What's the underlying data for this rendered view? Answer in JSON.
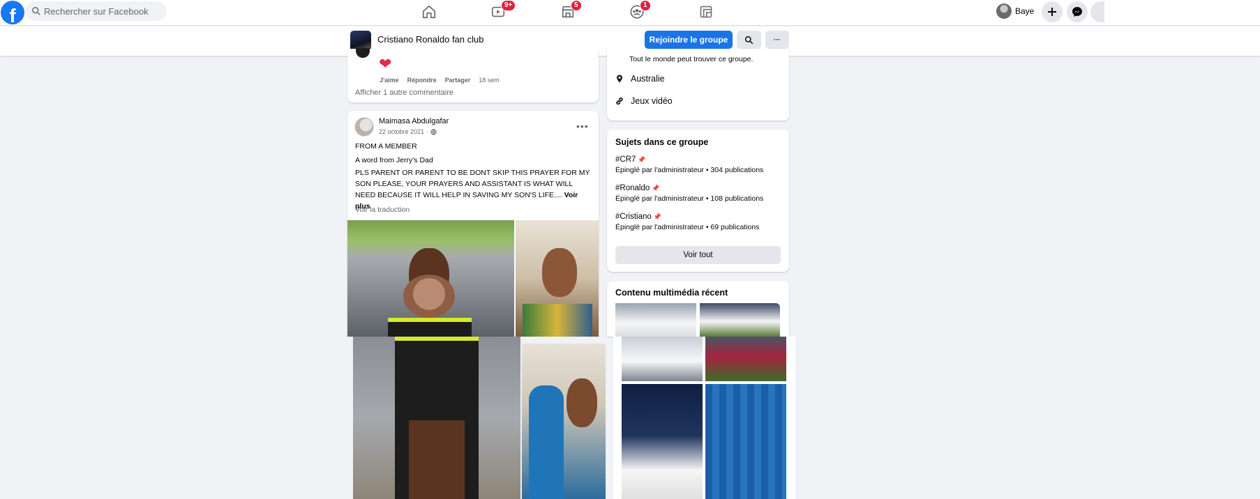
{
  "topbar": {
    "logo": "f",
    "search_placeholder": "Rechercher sur Facebook",
    "nav": [
      {
        "name": "home-icon",
        "badge": ""
      },
      {
        "name": "watch-icon",
        "badge": "9+"
      },
      {
        "name": "marketplace-icon",
        "badge": "5"
      },
      {
        "name": "groups-icon",
        "badge": "1"
      },
      {
        "name": "gaming-icon",
        "badge": ""
      }
    ],
    "profile_name": "Baye"
  },
  "group_header": {
    "name": "Cristiano Ronaldo fan club",
    "join_label": "Rejoindre le groupe",
    "more_label": "···"
  },
  "comment_block": {
    "reaction": "❤",
    "actions": [
      "J'aime",
      "Répondre",
      "Partager"
    ],
    "time": "18 sem",
    "more_comments": "Afficher 1 autre commentaire"
  },
  "post": {
    "author": "Maimasa Abdulgafar",
    "date": "22 octobre 2021 ·",
    "dots": "•••",
    "line1": "FROM A MEMBER",
    "line2": "A word from Jerry's  Dad",
    "body": "PLS PARENT OR PARENT TO BE DONT SKIP THIS PRAYER FOR MY SON PLEASE, YOUR PRAYERS AND ASSISTANT  IS WHAT WILL NEED BECAUSE IT WILL HELP IN SAVING MY SON'S LIFE....",
    "see_more": "Voir plus",
    "translate": "Voir la traduction"
  },
  "about": {
    "visibility": "Tout le monde peut trouver ce groupe.",
    "location": "Australie",
    "category": "Jeux vidéo"
  },
  "topics": {
    "title": "Sujets dans ce groupe",
    "items": [
      {
        "tag": "#CR7",
        "meta": "Épinglé par l'administrateur • 304 publications"
      },
      {
        "tag": "#Ronaldo",
        "meta": "Épinglé par l'administrateur • 108 publications"
      },
      {
        "tag": "#Cristiano",
        "meta": "Épinglé par l'administrateur • 69 publications"
      }
    ],
    "see_all": "Voir tout"
  },
  "media": {
    "title": "Contenu multimédia récent"
  },
  "colors": {
    "brand": "#1877f2",
    "join_button": "#1b74e4",
    "badge": "#e41e3f",
    "background": "#f0f2f5"
  }
}
